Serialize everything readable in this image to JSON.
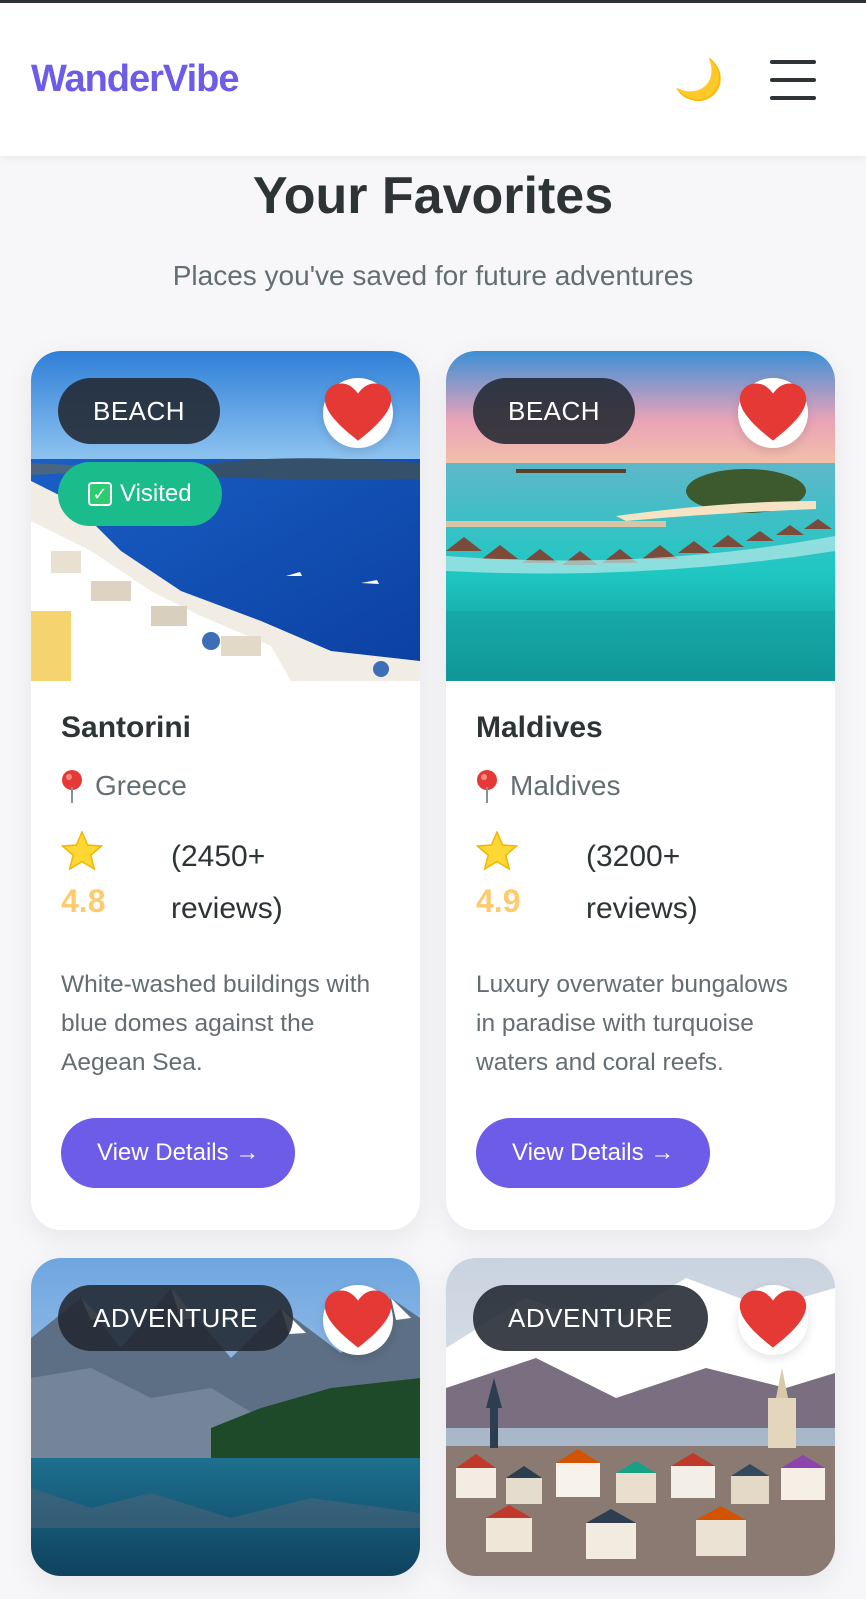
{
  "header": {
    "logo": "WanderVibe",
    "theme_icon": "🌙",
    "menu_icon": "hamburger-menu-icon"
  },
  "page": {
    "title": "Your Favorites",
    "subtitle": "Places you've saved for future adventures"
  },
  "colors": {
    "accent": "#6c5ce7",
    "visited": "#1abc8c",
    "rating": "#fdcb6e",
    "heart": "#e53935"
  },
  "cards": [
    {
      "category": "BEACH",
      "visited_label": "Visited",
      "name": "Santorini",
      "location": "Greece",
      "rating": "4.8",
      "reviews": "(2450+ reviews)",
      "description": "White-washed buildings with blue domes against the Aegean Sea.",
      "button": "View Details →"
    },
    {
      "category": "BEACH",
      "name": "Maldives",
      "location": "Maldives",
      "rating": "4.9",
      "reviews": "(3200+ reviews)",
      "description": "Luxury overwater bungalows in paradise with turquoise waters and coral reefs.",
      "button": "View Details →"
    },
    {
      "category": "ADVENTURE"
    },
    {
      "category": "ADVENTURE"
    }
  ]
}
